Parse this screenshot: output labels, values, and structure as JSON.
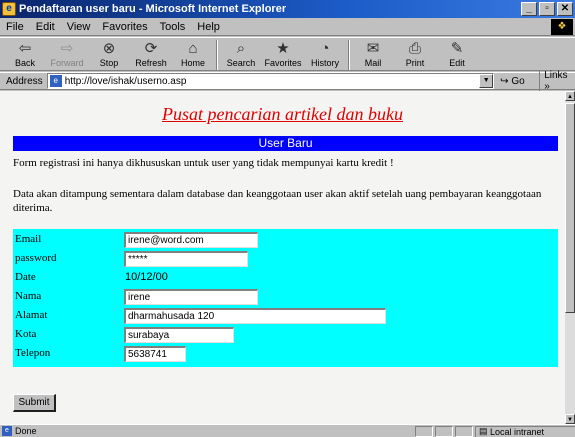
{
  "window": {
    "title": "Pendaftaran user baru - Microsoft Internet Explorer",
    "minimize": "_",
    "maximize": "▫",
    "close": "✕"
  },
  "menu": [
    "File",
    "Edit",
    "View",
    "Favorites",
    "Tools",
    "Help"
  ],
  "toolbar": [
    {
      "label": "Back",
      "icon": "back-arrow-icon",
      "glyph": "⇦",
      "disabled": false
    },
    {
      "label": "Forward",
      "icon": "forward-arrow-icon",
      "glyph": "⇨",
      "disabled": true
    },
    {
      "label": "Stop",
      "icon": "stop-icon",
      "glyph": "⊗",
      "disabled": false
    },
    {
      "label": "Refresh",
      "icon": "refresh-icon",
      "glyph": "⟳",
      "disabled": false
    },
    {
      "label": "Home",
      "icon": "home-icon",
      "glyph": "⌂",
      "disabled": false
    },
    {
      "label": "Search",
      "icon": "search-icon",
      "glyph": "⌕",
      "disabled": false
    },
    {
      "label": "Favorites",
      "icon": "favorites-icon",
      "glyph": "★",
      "disabled": false
    },
    {
      "label": "History",
      "icon": "history-icon",
      "glyph": "◔",
      "disabled": false
    },
    {
      "label": "Mail",
      "icon": "mail-icon",
      "glyph": "✉",
      "disabled": false
    },
    {
      "label": "Print",
      "icon": "print-icon",
      "glyph": "⎙",
      "disabled": false
    },
    {
      "label": "Edit",
      "icon": "edit-icon",
      "glyph": "✎",
      "disabled": false
    }
  ],
  "address": {
    "label": "Address",
    "url": "http://love/ishak/userno.asp",
    "go_label": "Go",
    "links_label": "Links »"
  },
  "page": {
    "heading": "Pusat pencarian artikel dan buku",
    "heading_color": "#e00000",
    "banner": "User Baru",
    "banner_color": "#0000ff",
    "intro": "Form registrasi ini hanya dikhususkan untuk user yang tidak mempunyai kartu kredit !",
    "notice": "Data akan ditampung sementara dalam database dan keanggotaan user akan aktif setelah uang pembayaran keanggotaan diterima.",
    "form_bg": "#00ffff",
    "form": {
      "email": {
        "label": "Email",
        "value": "irene@word.com"
      },
      "password": {
        "label": "password",
        "value": "*****"
      },
      "date": {
        "label": "Date",
        "value": "10/12/00"
      },
      "nama": {
        "label": "Nama",
        "value": "irene"
      },
      "alamat": {
        "label": "Alamat",
        "value": "dharmahusada 120"
      },
      "kota": {
        "label": "Kota",
        "value": "surabaya"
      },
      "telepon": {
        "label": "Telepon",
        "value": "5638741"
      }
    },
    "submit_label": "Submit"
  },
  "status": {
    "text": "Done",
    "zone": "Local intranet"
  }
}
